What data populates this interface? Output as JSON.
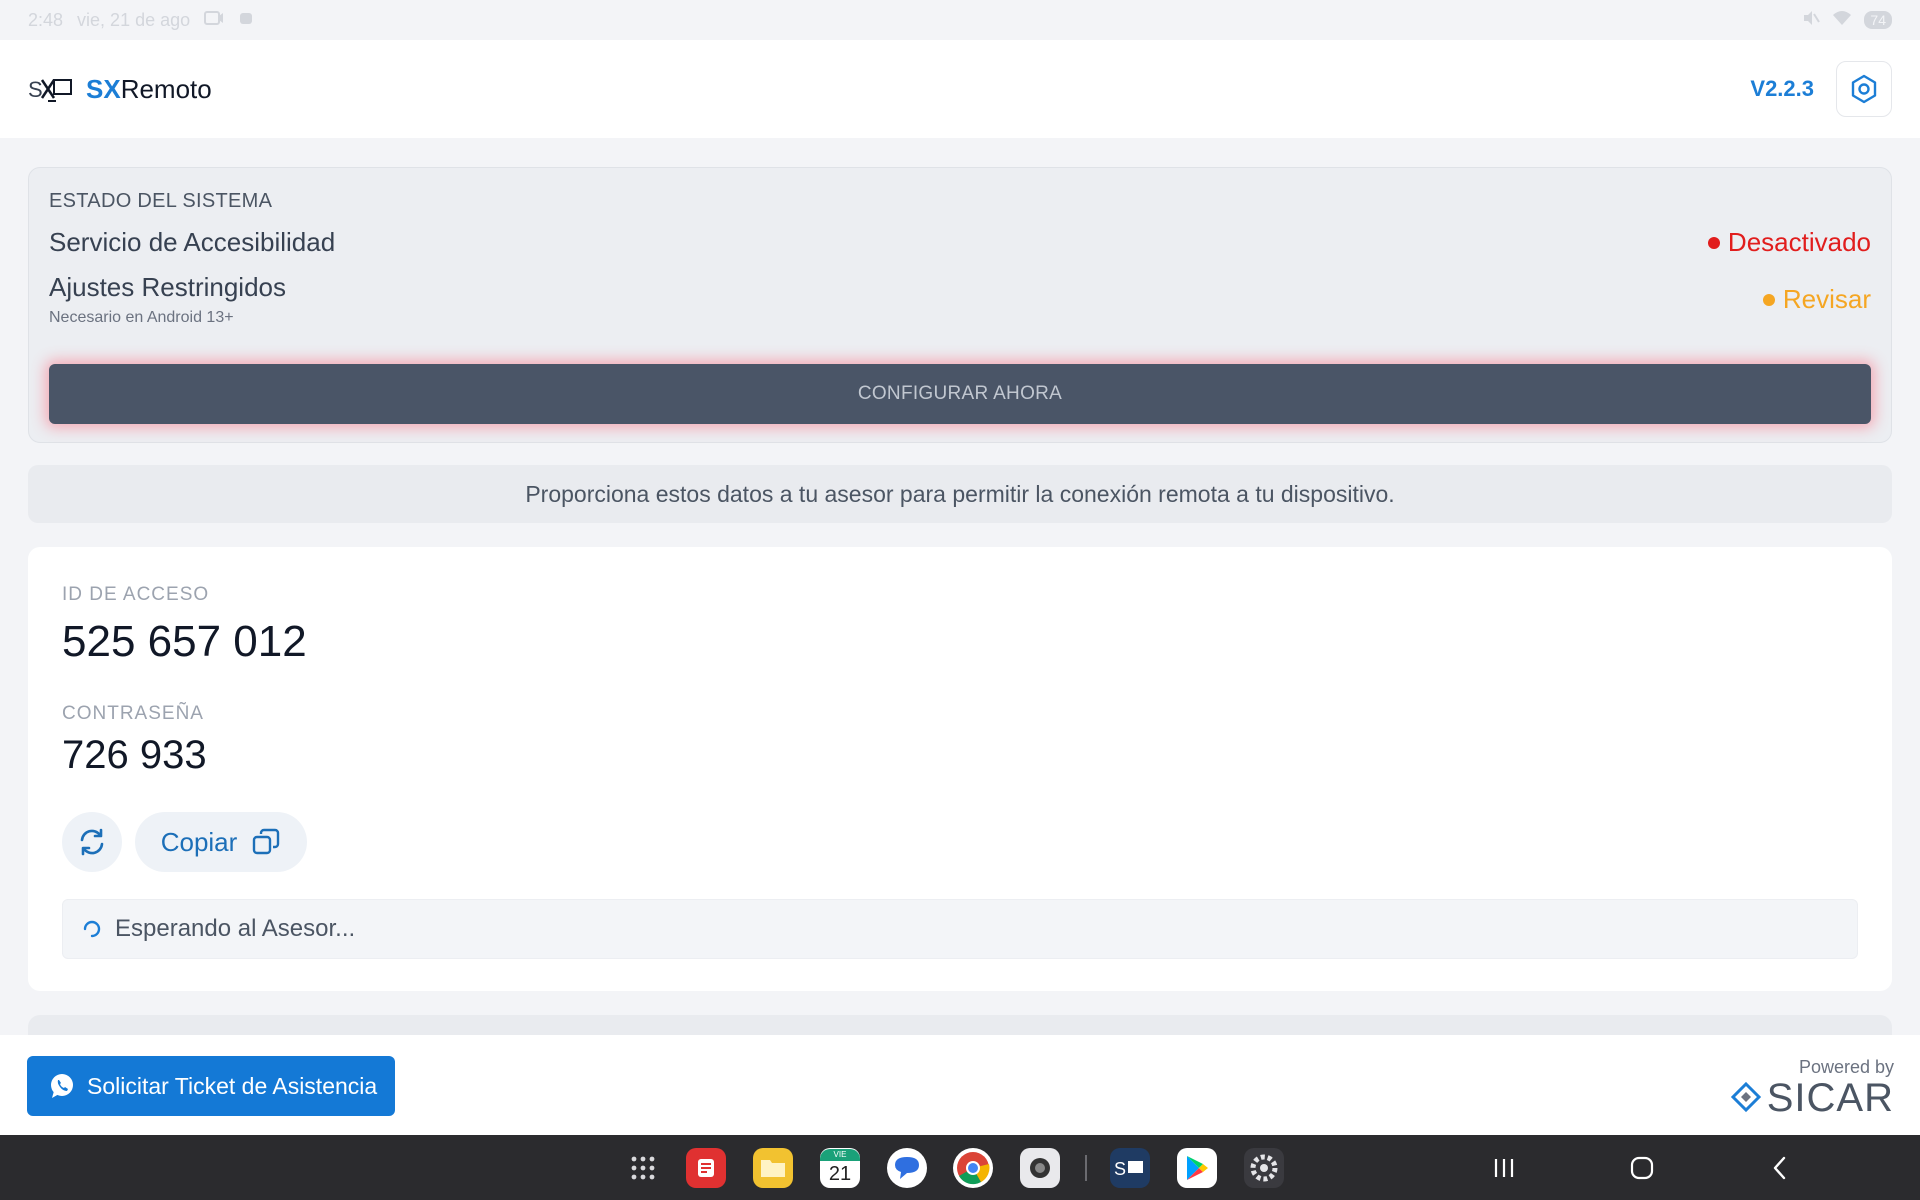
{
  "status_bar": {
    "time": "2:48",
    "date": "vie, 21 de ago",
    "battery": "74"
  },
  "app": {
    "brand_sx": "SX",
    "brand_rest": "Remoto",
    "version": "V2.2.3",
    "icons": {
      "logo": "sx-remote-logo-icon",
      "settings": "gear-icon"
    }
  },
  "system_status": {
    "title": "ESTADO DEL SISTEMA",
    "accessibility": {
      "label": "Servicio de Accesibilidad",
      "state": "Desactivado",
      "color": "#e11d1d"
    },
    "restricted": {
      "label": "Ajustes Restringidos",
      "sublabel": "Necesario en Android 13+",
      "state": "Revisar",
      "color": "#f5a623"
    },
    "configure_button": "CONFIGURAR AHORA"
  },
  "info_banner": "Proporciona estos datos a tu asesor para permitir la conexión remota a tu dispositivo.",
  "credentials": {
    "id_label": "ID DE ACCESO",
    "id_value": "525 657 012",
    "password_label": "CONTRASEÑA",
    "password_value": "726 933",
    "copy_label": "Copiar",
    "waiting_text": "Esperando al Asesor..."
  },
  "footer": {
    "ticket_button": "Solicitar Ticket de Asistencia",
    "powered_by": "Powered by",
    "powered_brand": "SICAR"
  },
  "navbar": {
    "calendar_day_label": "VIE",
    "calendar_day_number": "21",
    "apps": [
      "app-drawer-icon",
      "notes-app-icon",
      "files-app-icon",
      "calendar-app-icon",
      "messages-app-icon",
      "chrome-app-icon",
      "camera-app-icon",
      "sxremoto-app-icon",
      "play-store-app-icon",
      "settings-app-icon"
    ],
    "keys": [
      "recent-apps-icon",
      "home-icon",
      "back-icon"
    ]
  },
  "colors": {
    "accent": "#1c7ed6",
    "ticket_button": "#1479d6",
    "config_button": "#4a5567",
    "error": "#e11d1d",
    "warning": "#f5a623"
  }
}
